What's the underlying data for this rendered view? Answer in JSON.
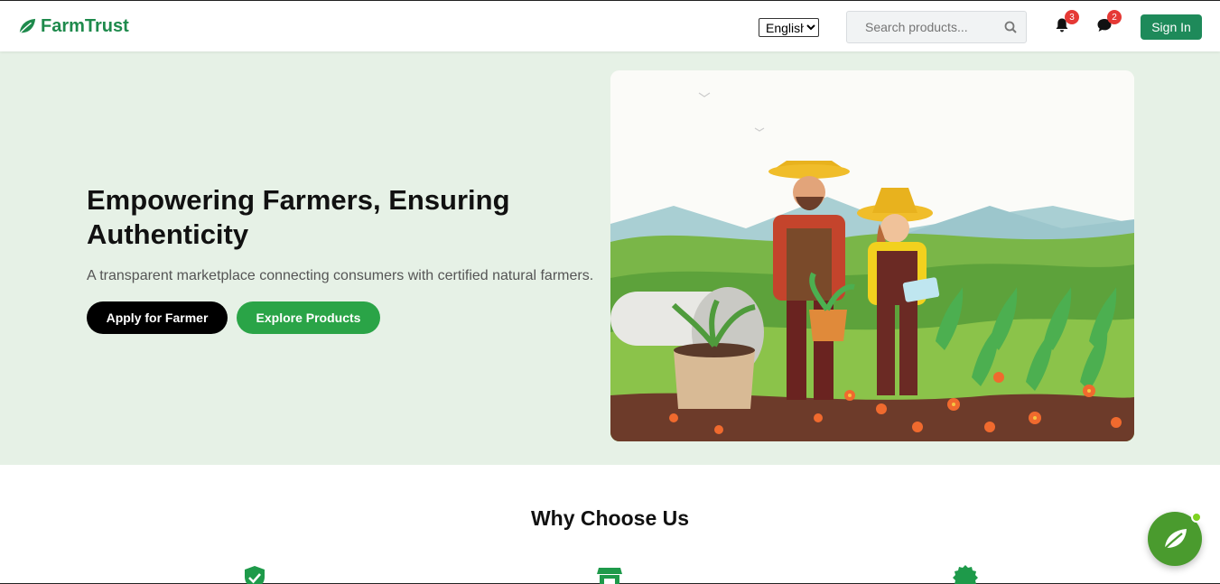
{
  "header": {
    "brand": "FarmTrust",
    "language": {
      "selected": "English",
      "options": [
        "English"
      ]
    },
    "search": {
      "placeholder": "Search products..."
    },
    "notifications": {
      "count": "3"
    },
    "messages": {
      "count": "2"
    },
    "signin_label": "Sign In"
  },
  "hero": {
    "title": "Empowering Farmers, Ensuring Authenticity",
    "subtitle": "A transparent marketplace connecting consumers with certified natural farmers.",
    "apply_label": "Apply for Farmer",
    "explore_label": "Explore Products"
  },
  "why": {
    "title": "Why Choose Us",
    "features": [
      {
        "icon": "shield-check-icon"
      },
      {
        "icon": "market-stall-icon"
      },
      {
        "icon": "badge-seal-icon"
      }
    ]
  },
  "chat": {
    "icon": "leaf-icon"
  },
  "colors": {
    "brand_green": "#1e8a4c",
    "explore_green": "#2aa447",
    "hero_bg": "#e6f1e6",
    "badge_red": "#e53935"
  }
}
